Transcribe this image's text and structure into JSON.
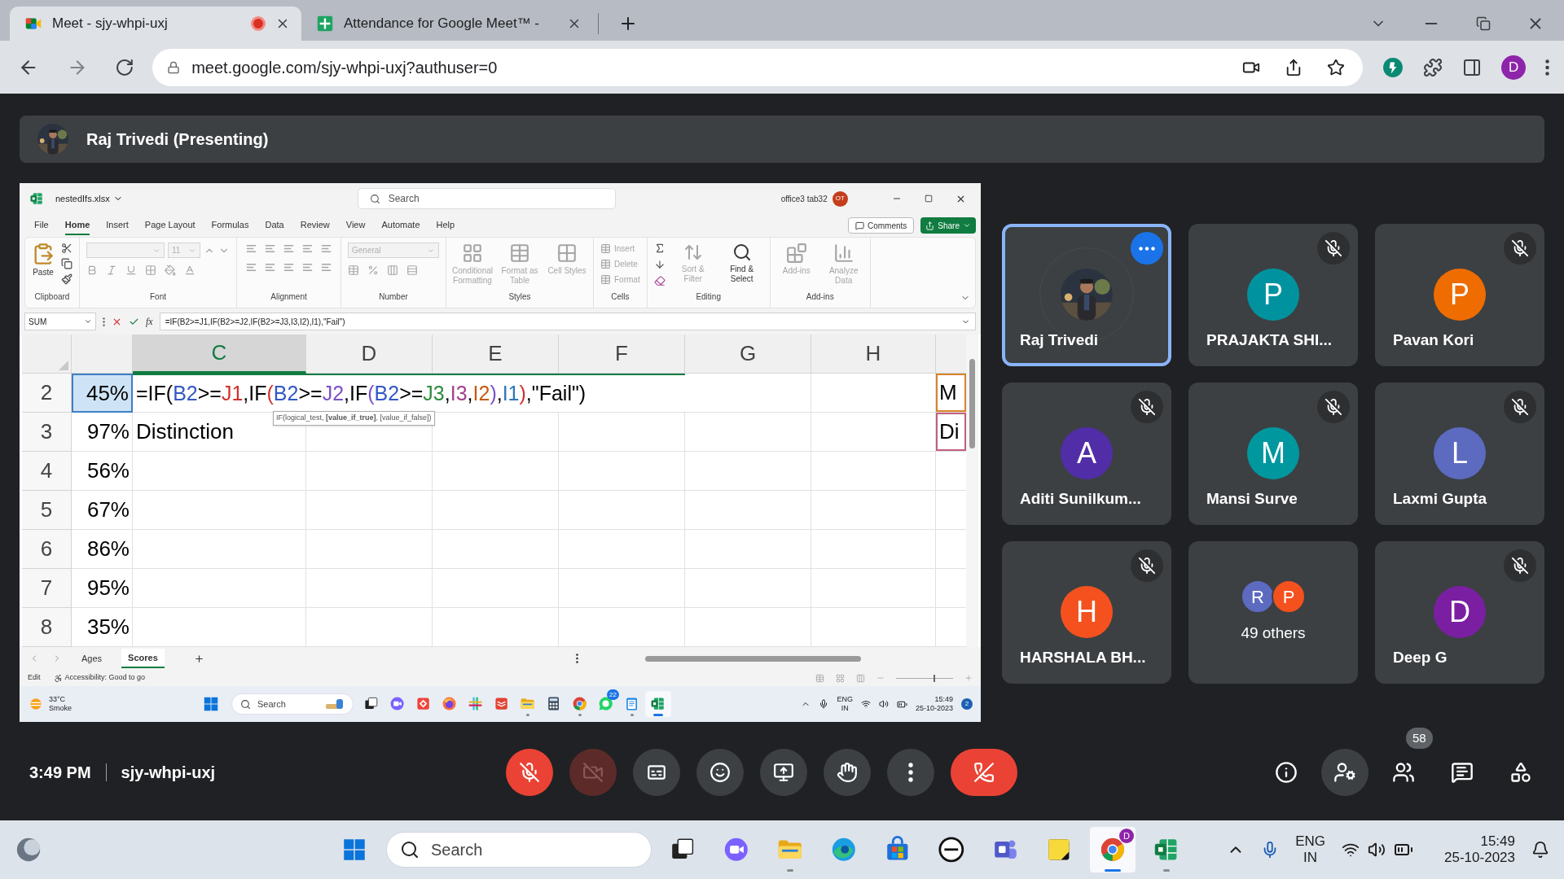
{
  "browser": {
    "tabs": [
      {
        "title": "Meet - sjy-whpi-uxj",
        "kind": "meet",
        "selected": true,
        "recording": true
      },
      {
        "title": "Attendance for Google Meet™ -",
        "kind": "sheets",
        "selected": false,
        "recording": false
      }
    ],
    "url": "meet.google.com/sjy-whpi-uxj?authuser=0",
    "profile": "D"
  },
  "presenting": {
    "label": "Raj Trivedi (Presenting)"
  },
  "excel": {
    "file": "nestedIfs.xlsx",
    "search": "Search",
    "account": "office3 tab32",
    "account_initials": "OT",
    "menu": [
      {
        "label": "File",
        "selected": false
      },
      {
        "label": "Home",
        "selected": true
      },
      {
        "label": "Insert",
        "selected": false
      },
      {
        "label": "Page Layout",
        "selected": false
      },
      {
        "label": "Formulas",
        "selected": false
      },
      {
        "label": "Data",
        "selected": false
      },
      {
        "label": "Review",
        "selected": false
      },
      {
        "label": "View",
        "selected": false
      },
      {
        "label": "Automate",
        "selected": false
      },
      {
        "label": "Help",
        "selected": false
      }
    ],
    "comments": "Comments",
    "share": "Share",
    "ribbon": [
      {
        "kind": "clipboard",
        "label": "Clipboard",
        "buttons": [
          {
            "label": "Paste",
            "disabled": false
          }
        ]
      },
      {
        "kind": "font",
        "label": "Font",
        "fields": [
          {
            "disabled": true
          },
          {
            "value": "11",
            "disabled": true
          }
        ]
      },
      {
        "kind": "alignment",
        "label": "Alignment"
      },
      {
        "kind": "number",
        "label": "Number",
        "fields": [
          {
            "value": "General",
            "disabled": true
          }
        ]
      },
      {
        "kind": "styles",
        "label": "Styles",
        "buttons": [
          {
            "label": "Conditional Formatting",
            "disabled": true
          },
          {
            "label": "Format as Table",
            "disabled": true
          },
          {
            "label": "Cell Styles",
            "disabled": true
          }
        ]
      },
      {
        "kind": "cells",
        "label": "Cells",
        "buttons": [
          {
            "label": "Insert",
            "disabled": true
          },
          {
            "label": "Delete",
            "disabled": true
          },
          {
            "label": "Format",
            "disabled": true
          }
        ]
      },
      {
        "kind": "editing",
        "label": "Editing",
        "buttons": [
          {
            "label": "Sort & Filter",
            "disabled": true
          },
          {
            "label": "Find & Select",
            "disabled": false
          }
        ]
      },
      {
        "kind": "addins",
        "label": "Add-ins",
        "buttons": [
          {
            "label": "Add-ins",
            "disabled": true
          },
          {
            "label": "Analyze Data",
            "disabled": true
          }
        ]
      }
    ],
    "name_box": "SUM",
    "function_label": "fx",
    "formula": "=IF(B2>=J1,IF(B2>=J2,IF(B2>=J3,I3,I2),I1),\"Fail\")",
    "columns": [
      {
        "label": "C",
        "selected": true
      },
      {
        "label": "D",
        "selected": false
      },
      {
        "label": "E",
        "selected": false
      },
      {
        "label": "F",
        "selected": false
      },
      {
        "label": "G",
        "selected": false
      },
      {
        "label": "H",
        "selected": false
      }
    ],
    "rows": [
      {
        "number": "2",
        "b": "45%",
        "selected": true,
        "editing": true,
        "right": {
          "text": "M",
          "color": "#d9822b"
        }
      },
      {
        "number": "3",
        "b": "97%",
        "selected": false,
        "editing": false,
        "c": "Distinction",
        "right": {
          "text": "Di",
          "color": "#c0607f"
        }
      },
      {
        "number": "4",
        "b": "56%",
        "selected": false,
        "editing": false
      },
      {
        "number": "5",
        "b": "67%",
        "selected": false,
        "editing": false
      },
      {
        "number": "6",
        "b": "86%",
        "selected": false,
        "editing": false
      },
      {
        "number": "7",
        "b": "95%",
        "selected": false,
        "editing": false
      },
      {
        "number": "8",
        "b": "35%",
        "selected": false,
        "editing": false
      }
    ],
    "formula_parts": [
      {
        "text": "=IF(",
        "color": "#000000"
      },
      {
        "text": "B2",
        "color": "#3358c4"
      },
      {
        "text": ">=",
        "color": "#000000"
      },
      {
        "text": "J1",
        "color": "#d0312d"
      },
      {
        "text": ",IF",
        "color": "#000000"
      },
      {
        "text": "(",
        "color": "#d0312d"
      },
      {
        "text": "B2",
        "color": "#3358c4"
      },
      {
        "text": ">=",
        "color": "#000000"
      },
      {
        "text": "J2",
        "color": "#7b4fc9"
      },
      {
        "text": ",IF",
        "color": "#000000"
      },
      {
        "text": "(",
        "color": "#7b4fc9"
      },
      {
        "text": "B2",
        "color": "#3358c4"
      },
      {
        "text": ">=",
        "color": "#000000"
      },
      {
        "text": "J3",
        "color": "#2e8b3e"
      },
      {
        "text": ",",
        "color": "#000000"
      },
      {
        "text": "I3",
        "color": "#a33f8a"
      },
      {
        "text": ",",
        "color": "#000000"
      },
      {
        "text": "I2",
        "color": "#c55a11"
      },
      {
        "text": ")",
        "color": "#7b4fc9"
      },
      {
        "text": ",",
        "color": "#000000"
      },
      {
        "text": "I1",
        "color": "#2e75b6"
      },
      {
        "text": ")",
        "color": "#d0312d"
      },
      {
        "text": ",\"Fail\")",
        "color": "#000000"
      }
    ],
    "tooltip": "IF(logical_test, **[value_if_true]**, [value_if_false])",
    "sheets": [
      {
        "label": "Ages",
        "selected": false
      },
      {
        "label": "Scores",
        "selected": true
      }
    ],
    "status": "Edit",
    "accessibility": "Accessibility: Good to go",
    "zoom": {
      "level": 0.65
    },
    "taskbar": {
      "temperature": "33°C",
      "weather": "Smoke",
      "search": "Search",
      "apps": [
        {
          "kind": "taskview",
          "open": false,
          "selected": false
        },
        {
          "kind": "video",
          "open": false,
          "selected": false
        },
        {
          "kind": "remote",
          "open": false,
          "selected": false
        },
        {
          "kind": "fox",
          "open": false,
          "selected": false
        },
        {
          "kind": "hash",
          "open": false,
          "selected": false
        },
        {
          "kind": "checklist",
          "open": false,
          "selected": false
        },
        {
          "kind": "folder",
          "open": true,
          "selected": false
        },
        {
          "kind": "calculator",
          "open": false,
          "selected": false
        },
        {
          "kind": "chrome",
          "open": true,
          "selected": false
        },
        {
          "kind": "chat",
          "open": false,
          "selected": false,
          "badge": "22"
        },
        {
          "kind": "notepad",
          "open": true,
          "selected": false
        },
        {
          "kind": "spreadsheet",
          "open": true,
          "selected": true
        }
      ],
      "lang": "ENG",
      "region": "IN",
      "time": "15:49",
      "date": "25-10-2023",
      "notifications": "2"
    }
  },
  "tiles": [
    {
      "name": "Raj Trivedi",
      "muted": false,
      "highlighted": true
    },
    {
      "kind": "person",
      "name": "PRAJAKTA SHI...",
      "initial": "P",
      "color": "#00939f",
      "muted": true,
      "highlighted": false
    },
    {
      "kind": "person",
      "name": "Pavan Kori",
      "initial": "P",
      "color": "#ef6c00",
      "muted": true,
      "highlighted": false
    },
    {
      "kind": "person",
      "name": "Aditi Sunilkum...",
      "initial": "A",
      "color": "#512da8",
      "muted": true,
      "highlighted": false
    },
    {
      "kind": "person",
      "name": "Mansi Surve",
      "initial": "M",
      "color": "#00979f",
      "muted": true,
      "highlighted": false
    },
    {
      "kind": "person",
      "name": "Laxmi Gupta",
      "initial": "L",
      "color": "#5c6bc0",
      "muted": true,
      "highlighted": false
    },
    {
      "kind": "person",
      "name": "HARSHALA BH...",
      "initial": "H",
      "color": "#f4511e",
      "muted": true,
      "highlighted": false
    },
    {
      "kind": "others",
      "name": "49 others",
      "initials": [
        {
          "initial": "R",
          "color": "#5c6bc0"
        },
        {
          "initial": "P",
          "color": "#f4511e"
        }
      ],
      "highlighted": false
    },
    {
      "kind": "person",
      "name": "Deep G",
      "initial": "D",
      "color": "#7b1fa2",
      "muted": true,
      "highlighted": false
    }
  ],
  "meeting": {
    "time": "3:49 PM",
    "code": "sjy-whpi-uxj",
    "controls": [
      {
        "kind": "mic",
        "on": false
      },
      {
        "kind": "camera",
        "on": false
      },
      {
        "kind": "captions"
      },
      {
        "kind": "reactions"
      },
      {
        "kind": "present"
      },
      {
        "kind": "hand"
      },
      {
        "kind": "more"
      },
      {
        "kind": "leave"
      }
    ],
    "side": [
      {
        "kind": "info",
        "selected": false
      },
      {
        "kind": "host",
        "selected": true
      },
      {
        "kind": "people",
        "selected": false,
        "badge": "58"
      },
      {
        "kind": "chat",
        "selected": false
      },
      {
        "kind": "activities",
        "selected": false
      }
    ]
  },
  "taskbar": {
    "search": "Search",
    "apps": [
      {
        "kind": "taskview",
        "open": false,
        "selected": false
      },
      {
        "kind": "video",
        "open": false,
        "selected": false
      },
      {
        "kind": "folder",
        "open": true,
        "selected": false
      },
      {
        "kind": "wave",
        "open": false,
        "selected": false
      },
      {
        "kind": "store",
        "open": false,
        "selected": false
      },
      {
        "kind": "circlelogo",
        "open": false,
        "selected": false
      },
      {
        "kind": "teams",
        "open": false,
        "selected": false
      },
      {
        "kind": "sticky",
        "open": false,
        "selected": false
      },
      {
        "kind": "chrome",
        "open": true,
        "selected": true,
        "badge": "D"
      },
      {
        "kind": "spreadsheet",
        "open": true,
        "selected": false
      }
    ],
    "lang": "ENG",
    "region": "IN",
    "time": "15:49",
    "date": "25-10-2023"
  }
}
